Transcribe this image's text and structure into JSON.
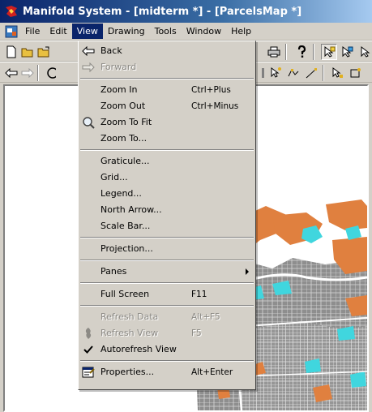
{
  "window": {
    "title": "Manifold System - [midterm *] - [ParcelsMap *]"
  },
  "menubar": {
    "items": [
      {
        "label": "File"
      },
      {
        "label": "Edit"
      },
      {
        "label": "View"
      },
      {
        "label": "Drawing"
      },
      {
        "label": "Tools"
      },
      {
        "label": "Window"
      },
      {
        "label": "Help"
      }
    ]
  },
  "view_menu": {
    "back": {
      "label": "Back"
    },
    "forward": {
      "label": "Forward"
    },
    "zoom_in": {
      "label": "Zoom In",
      "shortcut": "Ctrl+Plus"
    },
    "zoom_out": {
      "label": "Zoom Out",
      "shortcut": "Ctrl+Minus"
    },
    "zoom_to_fit": {
      "label": "Zoom To Fit"
    },
    "zoom_to": {
      "label": "Zoom To..."
    },
    "graticule": {
      "label": "Graticule..."
    },
    "grid": {
      "label": "Grid..."
    },
    "legend": {
      "label": "Legend..."
    },
    "north_arrow": {
      "label": "North Arrow..."
    },
    "scale_bar": {
      "label": "Scale Bar..."
    },
    "projection": {
      "label": "Projection..."
    },
    "panes": {
      "label": "Panes"
    },
    "full_screen": {
      "label": "Full Screen",
      "shortcut": "F11"
    },
    "refresh_data": {
      "label": "Refresh Data",
      "shortcut": "Alt+F5"
    },
    "refresh_view": {
      "label": "Refresh View",
      "shortcut": "F5"
    },
    "autorefresh_view": {
      "label": "Autorefresh View",
      "checked": true
    },
    "properties": {
      "label": "Properties...",
      "shortcut": "Alt+Enter"
    }
  },
  "colors": {
    "title_bar": "#0a246a",
    "menu_highlight": "#0a246a",
    "map_parcel_gray": "#9a9a9a",
    "map_orange": "#e08040",
    "map_cyan": "#40d8e0"
  }
}
